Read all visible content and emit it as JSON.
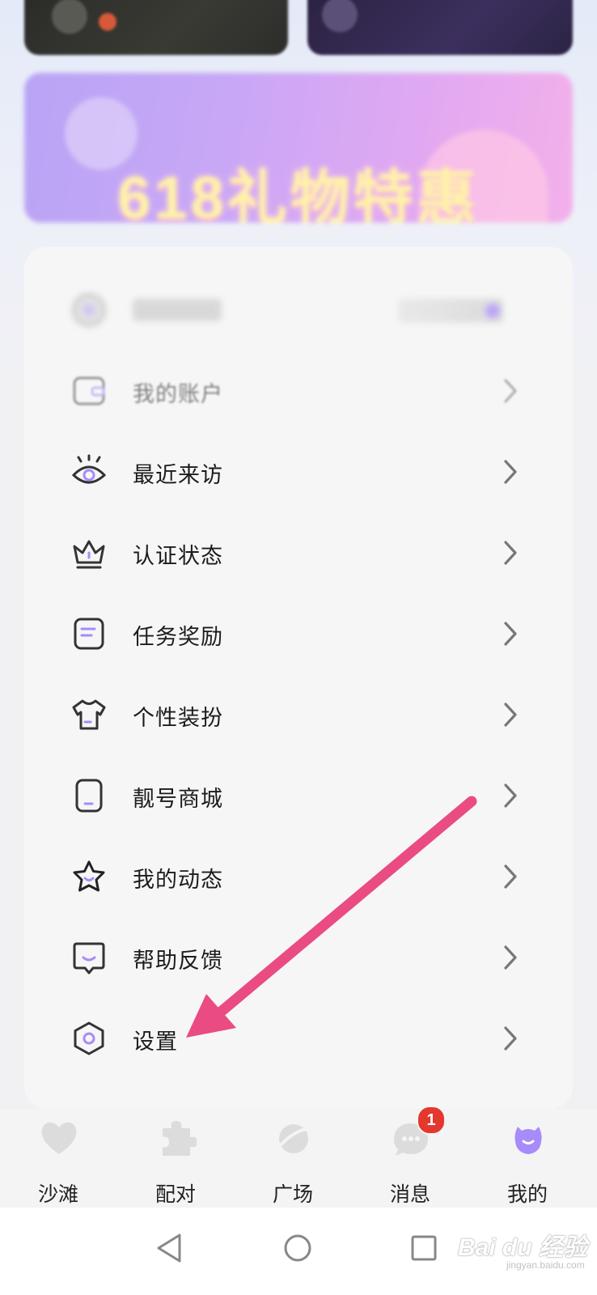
{
  "banner": {
    "title": "618礼物特惠"
  },
  "menu": {
    "items": [
      {
        "label": "我的账户",
        "icon": "wallet-icon"
      },
      {
        "label": "最近来访",
        "icon": "eye-icon"
      },
      {
        "label": "认证状态",
        "icon": "crown-icon"
      },
      {
        "label": "任务奖励",
        "icon": "task-list-icon"
      },
      {
        "label": "个性装扮",
        "icon": "tshirt-icon"
      },
      {
        "label": "靓号商城",
        "icon": "phone-icon"
      },
      {
        "label": "我的动态",
        "icon": "star-icon"
      },
      {
        "label": "帮助反馈",
        "icon": "chat-smile-icon"
      },
      {
        "label": "设置",
        "icon": "hexagon-settings-icon"
      }
    ]
  },
  "tabbar": {
    "tabs": [
      {
        "label": "沙滩",
        "icon": "heart-icon"
      },
      {
        "label": "配对",
        "icon": "puzzle-icon"
      },
      {
        "label": "广场",
        "icon": "planet-icon"
      },
      {
        "label": "消息",
        "icon": "message-icon",
        "badge": "1"
      },
      {
        "label": "我的",
        "icon": "profile-icon",
        "active": true
      }
    ]
  },
  "sysnav": {
    "buttons": [
      "back-icon",
      "home-icon",
      "recents-icon"
    ]
  },
  "watermark": {
    "text": "Bai du 经验",
    "sub": "jingyan.baidu.com"
  },
  "colors": {
    "accent": "#a78bfa",
    "arrow": "#ea4b83",
    "badge": "#e4372e"
  }
}
